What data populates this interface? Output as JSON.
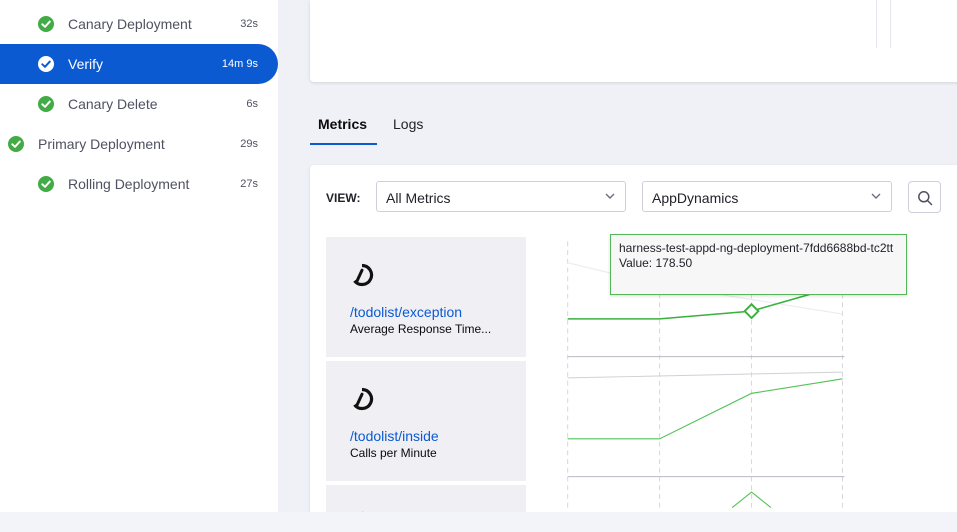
{
  "sidebar": {
    "steps": [
      {
        "label": "Canary Deployment",
        "duration": "32s",
        "status": "success",
        "active": false
      },
      {
        "label": "Verify",
        "duration": "14m 9s",
        "status": "success",
        "active": true
      },
      {
        "label": "Canary Delete",
        "duration": "6s",
        "status": "success",
        "active": false
      },
      {
        "label": "Primary Deployment",
        "duration": "29s",
        "status": "success",
        "active": false
      },
      {
        "label": "Rolling Deployment",
        "duration": "27s",
        "status": "success",
        "active": false
      }
    ]
  },
  "tabs": {
    "metrics": "Metrics",
    "logs": "Logs",
    "selected": "Metrics"
  },
  "filters": {
    "view_label": "VIEW:",
    "metric_select": "All Metrics",
    "provider_select": "AppDynamics"
  },
  "metrics": [
    {
      "name": "/todolist/exception",
      "subtitle": "Average Response Time..."
    },
    {
      "name": "/todolist/inside",
      "subtitle": "Calls per Minute"
    }
  ],
  "tooltip": {
    "host": "harness-test-appd-ng-deployment-7fdd6688bd-tc2tt",
    "value": "Value: 178.50"
  },
  "colors": {
    "accent": "#0b5ad1",
    "success": "#42ab45",
    "series": "#56c35a"
  },
  "icons": {
    "step_status": "check-circle-icon",
    "dropdown": "chevron-down-icon",
    "search": "search-icon",
    "provider_logo": "appdynamics-logo-icon"
  }
}
